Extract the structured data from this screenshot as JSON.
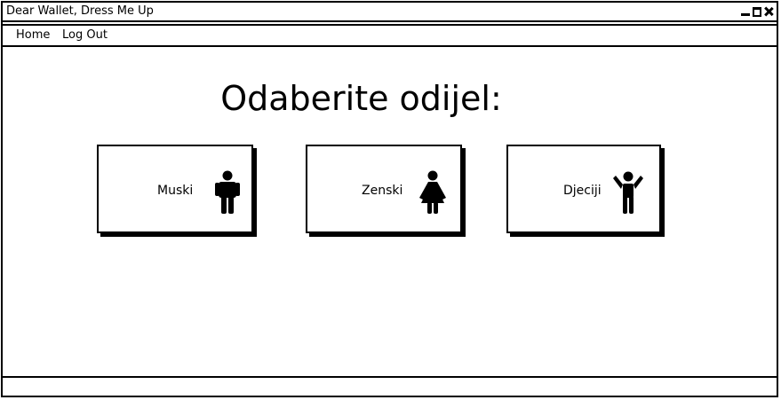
{
  "window": {
    "title": "Dear Wallet, Dress Me Up",
    "controls": [
      "minimize-icon",
      "maximize-icon",
      "close-icon"
    ]
  },
  "menu": {
    "items": [
      {
        "label": "Home"
      },
      {
        "label": "Log Out"
      }
    ]
  },
  "main": {
    "heading": "Odaberite odijel:",
    "categories": [
      {
        "label": "Muski",
        "icon": "man-icon"
      },
      {
        "label": "Zenski",
        "icon": "woman-icon"
      },
      {
        "label": "Djeciji",
        "icon": "child-icon"
      }
    ]
  },
  "status_bar": {
    "text": ""
  }
}
